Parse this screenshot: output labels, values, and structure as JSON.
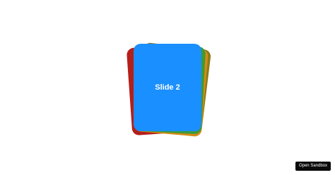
{
  "carousel": {
    "active_slide_label": "Slide 2",
    "colors": {
      "front": "#1a8fff",
      "stack": [
        "#b51f1a",
        "#8a7a19",
        "#d68a14",
        "#3c9a3a"
      ]
    }
  },
  "sandbox": {
    "button_label": "Open Sandbox"
  }
}
